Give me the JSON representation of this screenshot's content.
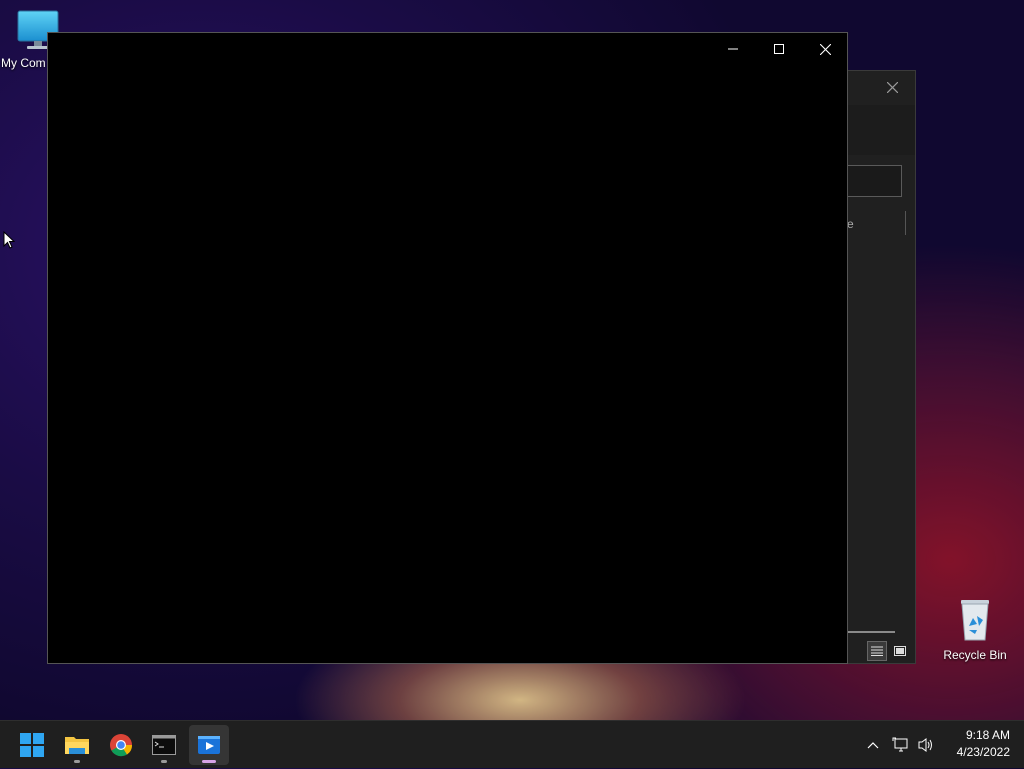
{
  "desktop": {
    "icons": [
      {
        "label": "My Com",
        "icon": "computer-icon"
      },
      {
        "label": "Recycle Bin",
        "icon": "recycle-bin-icon"
      }
    ]
  },
  "background_window": {
    "partial_text": "e"
  },
  "foreground_window": {
    "caption_buttons": [
      "minimize",
      "maximize",
      "close"
    ]
  },
  "taskbar": {
    "apps": [
      {
        "name": "start",
        "icon": "windows-start-icon"
      },
      {
        "name": "file-explorer",
        "icon": "folder-icon",
        "running": true
      },
      {
        "name": "chrome",
        "icon": "chrome-icon"
      },
      {
        "name": "command-prompt",
        "icon": "terminal-icon",
        "running": true
      },
      {
        "name": "media-player",
        "icon": "media-player-icon",
        "active": true
      }
    ],
    "clock": {
      "time": "9:18 AM",
      "date": "4/23/2022"
    }
  },
  "colors": {
    "taskbar_bg": "#1f1f1f",
    "window_bg": "#000000",
    "active_indicator": "#d6a3e6"
  }
}
